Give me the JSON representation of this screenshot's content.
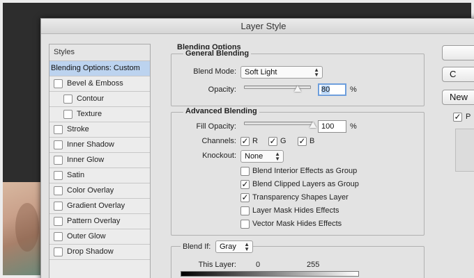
{
  "dialog": {
    "title": "Layer Style"
  },
  "styles_panel": {
    "header": "Styles",
    "items": [
      {
        "label": "Blending Options: Custom",
        "has_checkbox": false,
        "active": true,
        "indent": false
      },
      {
        "label": "Bevel & Emboss",
        "has_checkbox": true,
        "checked": false,
        "indent": false
      },
      {
        "label": "Contour",
        "has_checkbox": true,
        "checked": false,
        "indent": true
      },
      {
        "label": "Texture",
        "has_checkbox": true,
        "checked": false,
        "indent": true
      },
      {
        "label": "Stroke",
        "has_checkbox": true,
        "checked": false,
        "indent": false
      },
      {
        "label": "Inner Shadow",
        "has_checkbox": true,
        "checked": false,
        "indent": false
      },
      {
        "label": "Inner Glow",
        "has_checkbox": true,
        "checked": false,
        "indent": false
      },
      {
        "label": "Satin",
        "has_checkbox": true,
        "checked": false,
        "indent": false
      },
      {
        "label": "Color Overlay",
        "has_checkbox": true,
        "checked": false,
        "indent": false
      },
      {
        "label": "Gradient Overlay",
        "has_checkbox": true,
        "checked": false,
        "indent": false
      },
      {
        "label": "Pattern Overlay",
        "has_checkbox": true,
        "checked": false,
        "indent": false
      },
      {
        "label": "Outer Glow",
        "has_checkbox": true,
        "checked": false,
        "indent": false
      },
      {
        "label": "Drop Shadow",
        "has_checkbox": true,
        "checked": false,
        "indent": false
      }
    ]
  },
  "blending_options": {
    "title": "Blending Options",
    "general": {
      "title": "General Blending",
      "blend_mode_label": "Blend Mode:",
      "blend_mode_value": "Soft Light",
      "opacity_label": "Opacity:",
      "opacity_value": "80",
      "opacity_unit": "%",
      "opacity_level": 0.8
    },
    "advanced": {
      "title": "Advanced Blending",
      "fill_opacity_label": "Fill Opacity:",
      "fill_opacity_value": "100",
      "fill_opacity_unit": "%",
      "fill_opacity_level": 1.0,
      "channels_label": "Channels:",
      "channels": [
        {
          "label": "R",
          "checked": true
        },
        {
          "label": "G",
          "checked": true
        },
        {
          "label": "B",
          "checked": true
        }
      ],
      "knockout_label": "Knockout:",
      "knockout_value": "None",
      "options": [
        {
          "label": "Blend Interior Effects as Group",
          "checked": false
        },
        {
          "label": "Blend Clipped Layers as Group",
          "checked": true
        },
        {
          "label": "Transparency Shapes Layer",
          "checked": true
        },
        {
          "label": "Layer Mask Hides Effects",
          "checked": false
        },
        {
          "label": "Vector Mask Hides Effects",
          "checked": false
        }
      ]
    },
    "blend_if": {
      "label": "Blend If:",
      "value": "Gray",
      "this_layer_label": "This Layer:",
      "this_layer_min": "0",
      "this_layer_max": "255"
    }
  },
  "buttons": {
    "ok_label": "",
    "cancel_label": "C",
    "new_style_label": "New",
    "preview_label": "P",
    "preview_checked": true
  },
  "colors": {
    "active_row": "#bcd3ef",
    "focus_ring": "#6d9edc",
    "dialog_bg": "#e3e3e3",
    "backdrop": "#2d2d2d"
  }
}
